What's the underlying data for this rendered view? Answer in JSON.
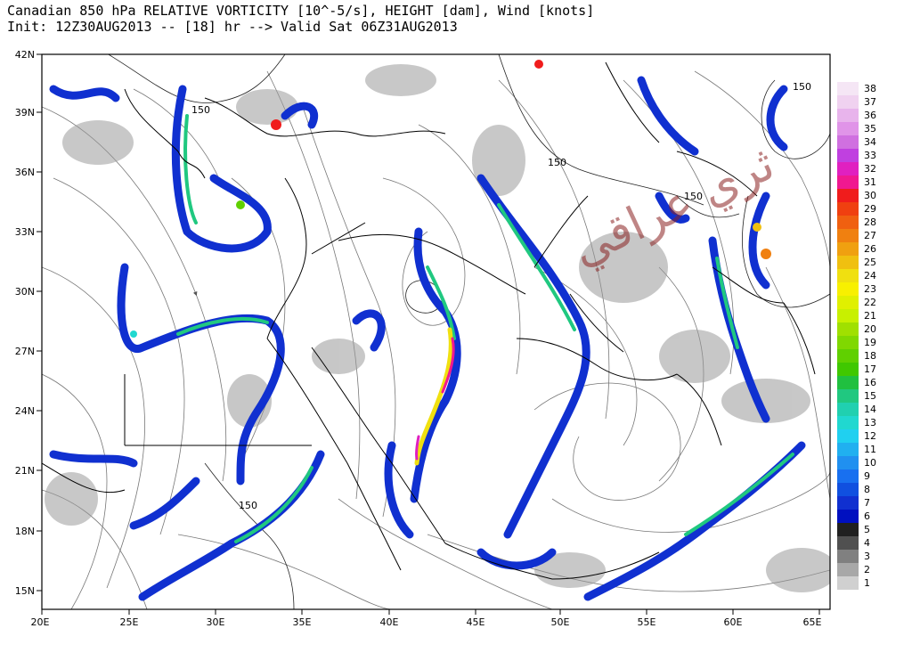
{
  "header": {
    "title": "Canadian 850 hPa RELATIVE VORTICITY [10^-5/s], HEIGHT [dam], Wind [knots]",
    "subtitle": "Init: 12Z30AUG2013 -- [18] hr --> Valid Sat 06Z31AUG2013"
  },
  "map": {
    "lat_ticks": [
      "42N",
      "39N",
      "36N",
      "33N",
      "30N",
      "27N",
      "24N",
      "21N",
      "18N",
      "15N"
    ],
    "lon_ticks": [
      "20E",
      "25E",
      "30E",
      "35E",
      "40E",
      "45E",
      "50E",
      "55E",
      "60E",
      "65E"
    ],
    "contour_labels": [
      "150",
      "150",
      "150",
      "150",
      "150"
    ],
    "watermark": "ثري عراقي"
  },
  "colorbar": {
    "labels": [
      "38",
      "37",
      "36",
      "35",
      "34",
      "33",
      "32",
      "31",
      "30",
      "29",
      "28",
      "27",
      "26",
      "25",
      "24",
      "23",
      "22",
      "21",
      "20",
      "19",
      "18",
      "17",
      "16",
      "15",
      "14",
      "13",
      "12",
      "11",
      "10",
      "9",
      "8",
      "7",
      "6",
      "5",
      "4",
      "3",
      "2",
      "1"
    ],
    "colors": [
      "#f5e6f5",
      "#f0d2f0",
      "#e8b4ec",
      "#e094e8",
      "#d070e0",
      "#c040e0",
      "#e020c0",
      "#f01890",
      "#f01c1c",
      "#f04010",
      "#f06010",
      "#f08010",
      "#f0a010",
      "#f0c010",
      "#f0e010",
      "#f8f000",
      "#e0f000",
      "#c8f000",
      "#a0e000",
      "#80d800",
      "#60d000",
      "#40c800",
      "#20c040",
      "#20c880",
      "#20d0b0",
      "#20d8d0",
      "#20d0f0",
      "#20b0f0",
      "#2090f0",
      "#1870f0",
      "#1050e0",
      "#1030d0",
      "#0010c0",
      "#202020",
      "#505050",
      "#808080",
      "#a8a8a8",
      "#d0d0d0"
    ]
  }
}
